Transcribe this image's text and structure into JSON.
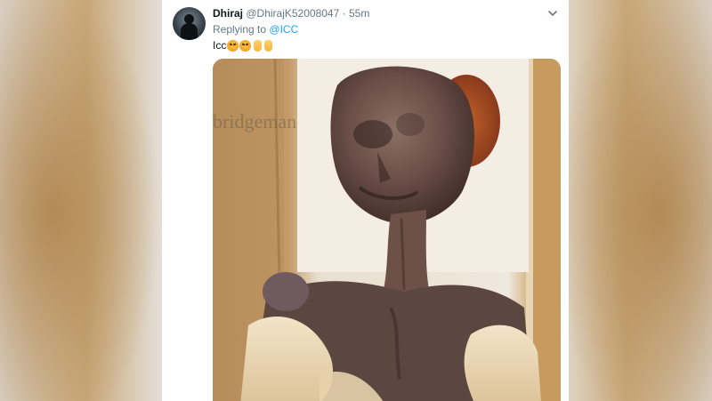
{
  "tweet": {
    "display_name": "Dhiraj",
    "handle": "@DhirajK52008047",
    "separator": "·",
    "time": "55m",
    "reply_prefix": "Replying to",
    "reply_mention": "@ICC",
    "text": "Icc",
    "emojis": [
      "angry-face-icon",
      "angry-face-icon",
      "pointing-down-icon",
      "pointing-down-icon"
    ]
  },
  "media": {
    "watermark": "bridgeman"
  },
  "colors": {
    "link": "#1da1f2",
    "secondary_text": "#657786",
    "primary_text": "#14171a"
  }
}
